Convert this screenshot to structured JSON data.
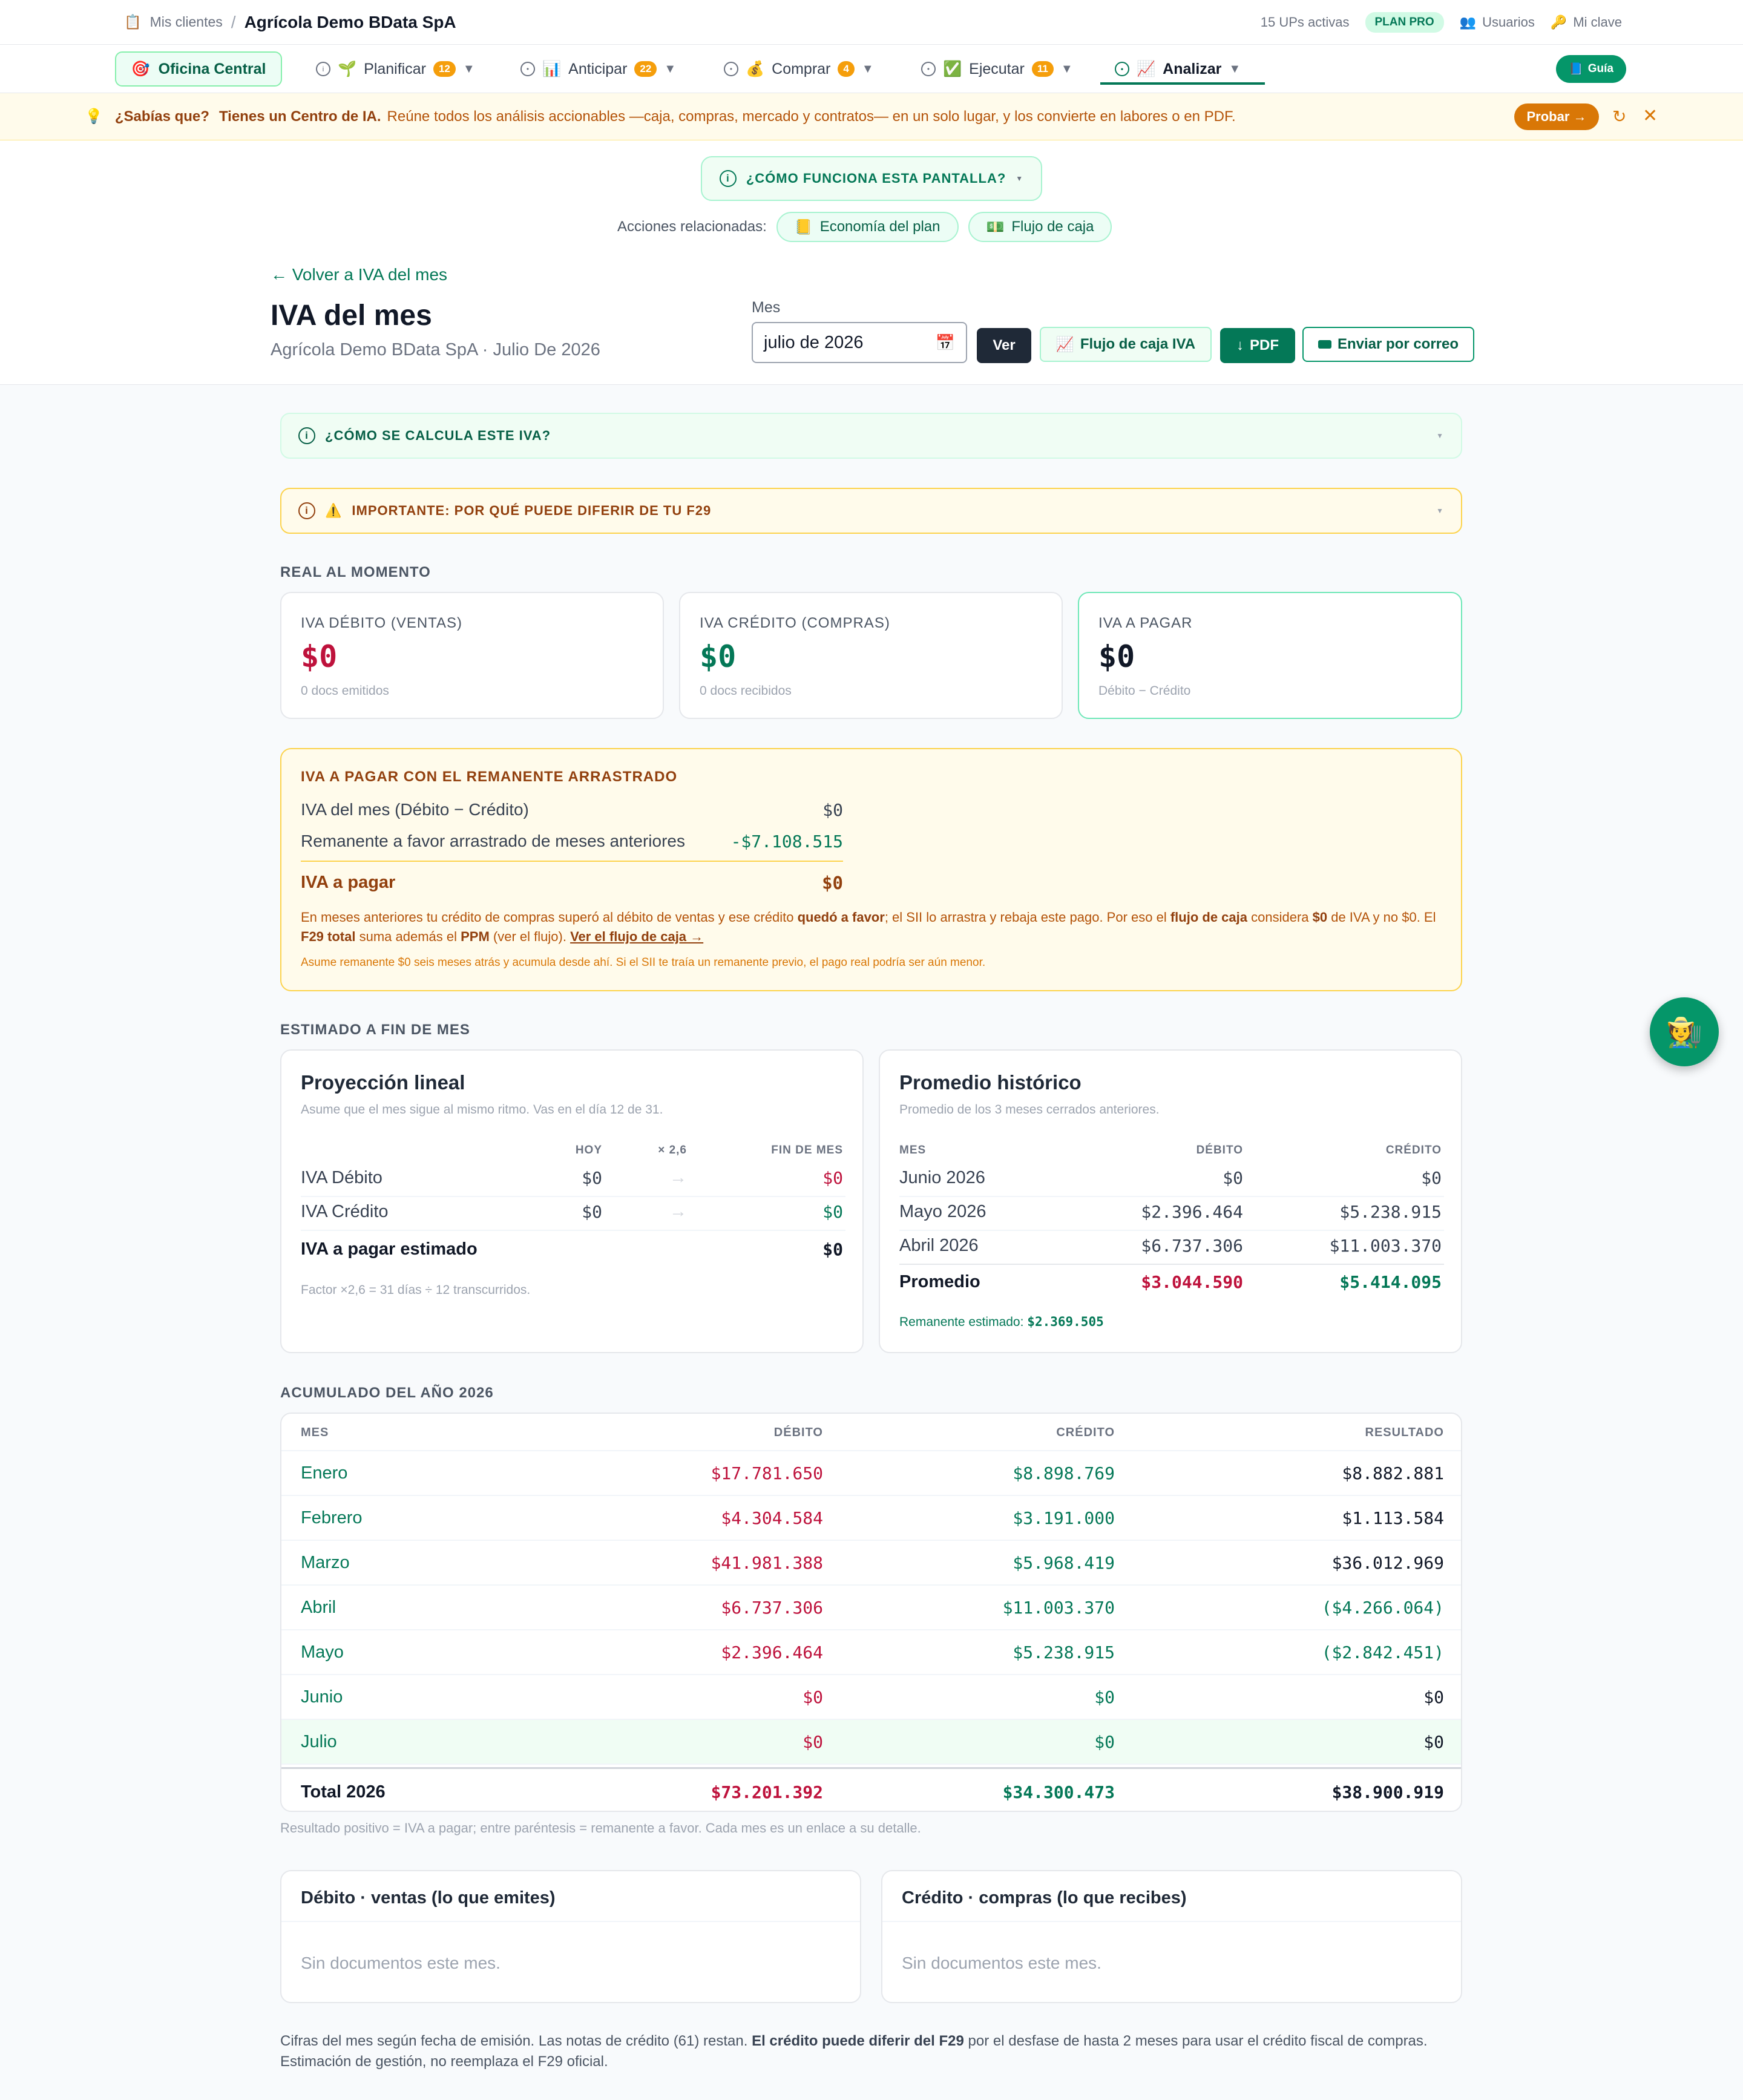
{
  "topbar": {
    "crumb": "Mis clientes",
    "company": "Agrícola Demo BData SpA",
    "ups": "15 UPs activas",
    "plan": "PLAN PRO",
    "users": "Usuarios",
    "key": "Mi clave"
  },
  "nav": {
    "office": "Oficina Central",
    "items": [
      {
        "label": "Planificar",
        "badge": "12"
      },
      {
        "label": "Anticipar",
        "badge": "22"
      },
      {
        "label": "Comprar",
        "badge": "4"
      },
      {
        "label": "Ejecutar",
        "badge": "11"
      },
      {
        "label": "Analizar"
      }
    ],
    "guia": "Guía"
  },
  "tip": {
    "lead": "¿Sabías que?",
    "strong": "Tienes un Centro de IA.",
    "text": "Reúne todos los análisis accionables —caja, compras, mercado y contratos— en un solo lugar, y los convierte en labores o en PDF.",
    "cta": "Probar →"
  },
  "header": {
    "how": "¿CÓMO FUNCIONA ESTA PANTALLA?",
    "related_label": "Acciones relacionadas:",
    "related": [
      "Economía del plan",
      "Flujo de caja"
    ],
    "back": "← Volver a IVA del mes",
    "title": "IVA del mes",
    "subtitle": "Agrícola Demo BData SpA · Julio De 2026",
    "mes_label": "Mes",
    "mes_value": "julio de 2026",
    "btn_ver": "Ver",
    "btn_flujo": "Flujo de caja IVA",
    "btn_pdf": "PDF",
    "btn_mail": "Enviar por correo"
  },
  "collapses": {
    "calc": "¿CÓMO SE CALCULA ESTE IVA?",
    "f29": "IMPORTANTE: POR QUÉ PUEDE DIFERIR DE TU F29"
  },
  "real": {
    "section": "REAL AL MOMENTO",
    "debito": {
      "label": "IVA DÉBITO (VENTAS)",
      "value": "$0",
      "note": "0 docs emitidos"
    },
    "credito": {
      "label": "IVA CRÉDITO (COMPRAS)",
      "value": "$0",
      "note": "0 docs recibidos"
    },
    "pagar": {
      "label": "IVA A PAGAR",
      "value": "$0",
      "note": "Débito − Crédito"
    }
  },
  "remanente": {
    "title": "IVA A PAGAR CON EL REMANENTE ARRASTRADO",
    "row1_label": "IVA del mes (Débito − Crédito)",
    "row1_value": "$0",
    "row2_label": "Remanente a favor arrastrado de meses anteriores",
    "row2_value": "-$7.108.515",
    "total_label": "IVA a pagar",
    "total_value": "$0",
    "text_a": "En meses anteriores tu crédito de compras superó al débito de ventas y ese crédito ",
    "text_b": "quedó a favor",
    "text_c": "; el SII lo arrastra y rebaja este pago. Por eso el ",
    "text_d": "flujo de caja",
    "text_e": " considera ",
    "text_f": "$0",
    "text_g": " de IVA y no $0. El ",
    "text_h": "F29 total",
    "text_i": " suma además el ",
    "text_j": "PPM",
    "text_k": " (ver el flujo). ",
    "text_link": "Ver el flujo de caja →",
    "foot": "Asume remanente $0 seis meses atrás y acumula desde ahí. Si el SII te traía un remanente previo, el pago real podría ser aún menor."
  },
  "estimado": {
    "section": "ESTIMADO A FIN DE MES",
    "lineal": {
      "title": "Proyección lineal",
      "sub": "Asume que el mes sigue al mismo ritmo. Vas en el día 12 de 31.",
      "h_hoy": "HOY",
      "h_factor": "× 2,6",
      "h_fin": "FIN DE MES",
      "rows": [
        {
          "label": "IVA Débito",
          "hoy": "$0",
          "fin": "$0"
        },
        {
          "label": "IVA Crédito",
          "hoy": "$0",
          "fin": "$0"
        }
      ],
      "total_label": "IVA a pagar estimado",
      "total_value": "$0",
      "note": "Factor ×2,6 = 31 días ÷ 12 transcurridos."
    },
    "historico": {
      "title": "Promedio histórico",
      "sub": "Promedio de los 3 meses cerrados anteriores.",
      "h_mes": "MES",
      "h_deb": "DÉBITO",
      "h_cre": "CRÉDITO",
      "rows": [
        {
          "mes": "Junio 2026",
          "deb": "$0",
          "cre": "$0"
        },
        {
          "mes": "Mayo 2026",
          "deb": "$2.396.464",
          "cre": "$5.238.915"
        },
        {
          "mes": "Abril 2026",
          "deb": "$6.737.306",
          "cre": "$11.003.370"
        }
      ],
      "avg_label": "Promedio",
      "avg_deb": "$3.044.590",
      "avg_cre": "$5.414.095",
      "rem_label": "Remanente estimado:",
      "rem_value": "$2.369.505"
    }
  },
  "acumulado": {
    "section": "ACUMULADO DEL AÑO 2026",
    "h_mes": "MES",
    "h_deb": "DÉBITO",
    "h_cre": "CRÉDITO",
    "h_res": "RESULTADO",
    "rows": [
      {
        "mes": "Enero",
        "deb": "$17.781.650",
        "cre": "$8.898.769",
        "res": "$8.882.881"
      },
      {
        "mes": "Febrero",
        "deb": "$4.304.584",
        "cre": "$3.191.000",
        "res": "$1.113.584"
      },
      {
        "mes": "Marzo",
        "deb": "$41.981.388",
        "cre": "$5.968.419",
        "res": "$36.012.969"
      },
      {
        "mes": "Abril",
        "deb": "$6.737.306",
        "cre": "$11.003.370",
        "res": "($4.266.064)"
      },
      {
        "mes": "Mayo",
        "deb": "$2.396.464",
        "cre": "$5.238.915",
        "res": "($2.842.451)"
      },
      {
        "mes": "Junio",
        "deb": "$0",
        "cre": "$0",
        "res": "$0"
      },
      {
        "mes": "Julio",
        "deb": "$0",
        "cre": "$0",
        "res": "$0"
      }
    ],
    "total_label": "Total 2026",
    "total_deb": "$73.201.392",
    "total_cre": "$34.300.473",
    "total_res": "$38.900.919",
    "note": "Resultado positivo = IVA a pagar; entre paréntesis = remanente a favor. Cada mes es un enlace a su detalle."
  },
  "docs": {
    "debito_title": "Débito · ventas (lo que emites)",
    "credito_title": "Crédito · compras (lo que recibes)",
    "empty": "Sin documentos este mes."
  },
  "bottom": {
    "a": "Cifras del mes según fecha de emisión. Las notas de crédito (61) restan. ",
    "b": "El crédito puede diferir del F29",
    "c": " por el desfase de hasta 2 meses para usar el crédito fiscal de compras. Estimación de gestión, no reemplaza el F29 oficial."
  },
  "colors": {
    "accent": "#047857",
    "debit": "#be123c",
    "warning": "#f59e0b"
  }
}
